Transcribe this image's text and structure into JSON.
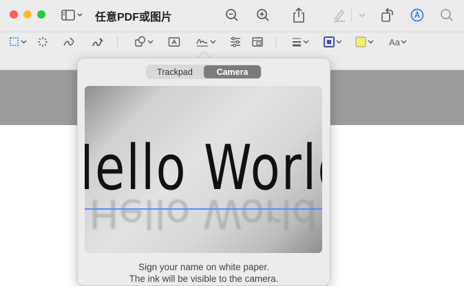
{
  "window": {
    "title": "任意PDF或图片"
  },
  "toolbar": {
    "font_button_label": "Aa",
    "icons": [
      "sidebar-icon",
      "chevron-down-icon",
      "zoom-out-icon",
      "zoom-in-icon",
      "share-icon",
      "highlight-pen-icon",
      "rotate-icon",
      "markup-icon",
      "search-icon"
    ],
    "markup_icons": [
      "rectangular-selection-icon",
      "instant-alpha-icon",
      "sketch-icon",
      "draw-icon",
      "shapes-icon",
      "text-box-icon",
      "signature-icon",
      "adjust-color-icon",
      "page-layout-icon",
      "line-style-icon",
      "border-color-icon",
      "fill-color-icon",
      "text-style-icon"
    ],
    "border_color": "#3b4cc0",
    "fill_color": "#f7ef6a"
  },
  "signature_popover": {
    "tabs": [
      {
        "label": "Trackpad",
        "selected": false
      },
      {
        "label": "Camera",
        "selected": true
      }
    ],
    "camera_text": "Hello World",
    "hint_line1": "Sign your name on white paper.",
    "hint_line2": "The ink will be visible to the camera."
  },
  "colors": {
    "accent": "#2f7bf5",
    "window_bg": "#ececec",
    "canvas_gray": "#9b9b9b",
    "baseline": "#5b8fe0"
  }
}
